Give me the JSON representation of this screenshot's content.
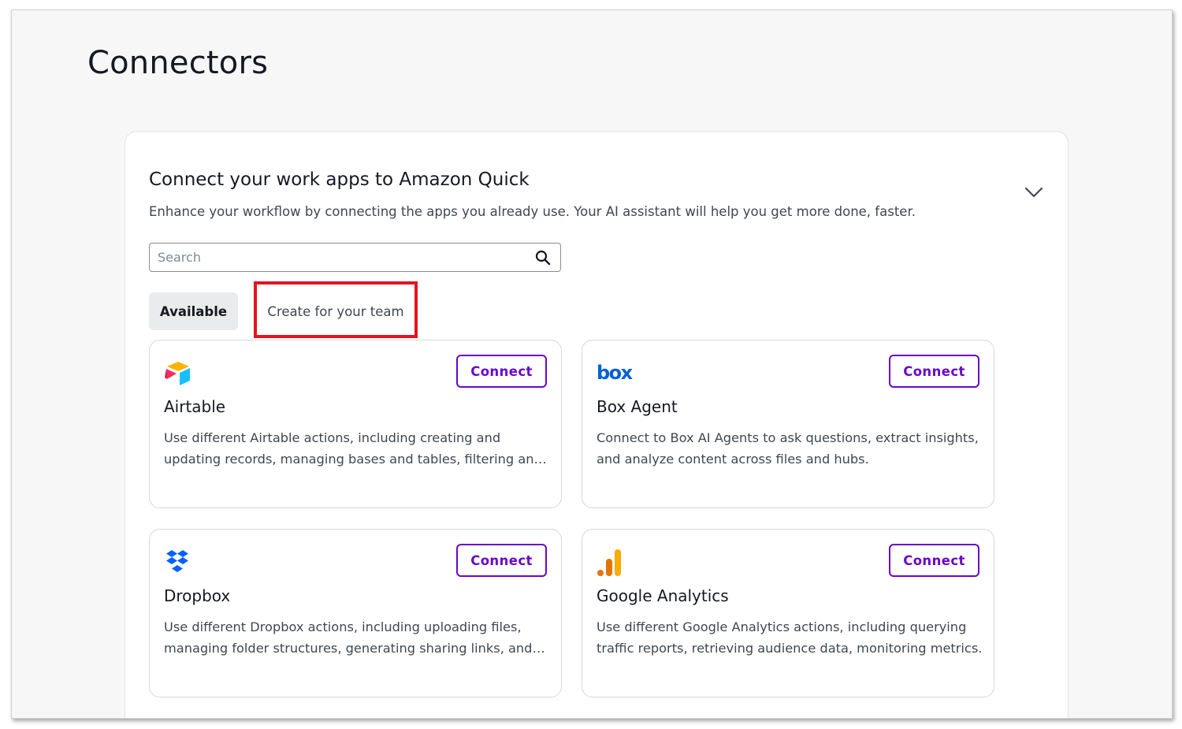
{
  "page": {
    "title": "Connectors"
  },
  "panel": {
    "title": "Connect your work apps to Amazon Quick",
    "subtitle": "Enhance your workflow by connecting the apps you already use. Your AI assistant will help you get more done, faster.",
    "collapse_icon": "chevron-down-icon"
  },
  "search": {
    "placeholder": "Search",
    "value": "",
    "icon": "search-icon"
  },
  "tabs": [
    {
      "label": "Available",
      "selected": true
    },
    {
      "label": "Create for your team",
      "selected": false,
      "highlight_color": "#e3141f"
    }
  ],
  "connect_label": "Connect",
  "colors": {
    "accent": "#6b06c9",
    "highlight": "#e3141f"
  },
  "connectors": [
    {
      "name": "Airtable",
      "icon": "airtable-logo-icon",
      "description": "Use different Airtable actions, including creating and updating records, managing bases and tables, filtering and sorting records."
    },
    {
      "name": "Box Agent",
      "icon": "box-logo-icon",
      "logo_text": "box",
      "description": "Connect to Box AI Agents to ask questions, extract insights, and analyze content across files and hubs."
    },
    {
      "name": "Dropbox",
      "icon": "dropbox-logo-icon",
      "description": "Use different Dropbox actions, including uploading files, managing folder structures, generating sharing links, and more."
    },
    {
      "name": "Google Analytics",
      "icon": "google-analytics-logo-icon",
      "description": "Use different Google Analytics actions, including querying traffic reports, retrieving audience data, monitoring metrics."
    }
  ]
}
